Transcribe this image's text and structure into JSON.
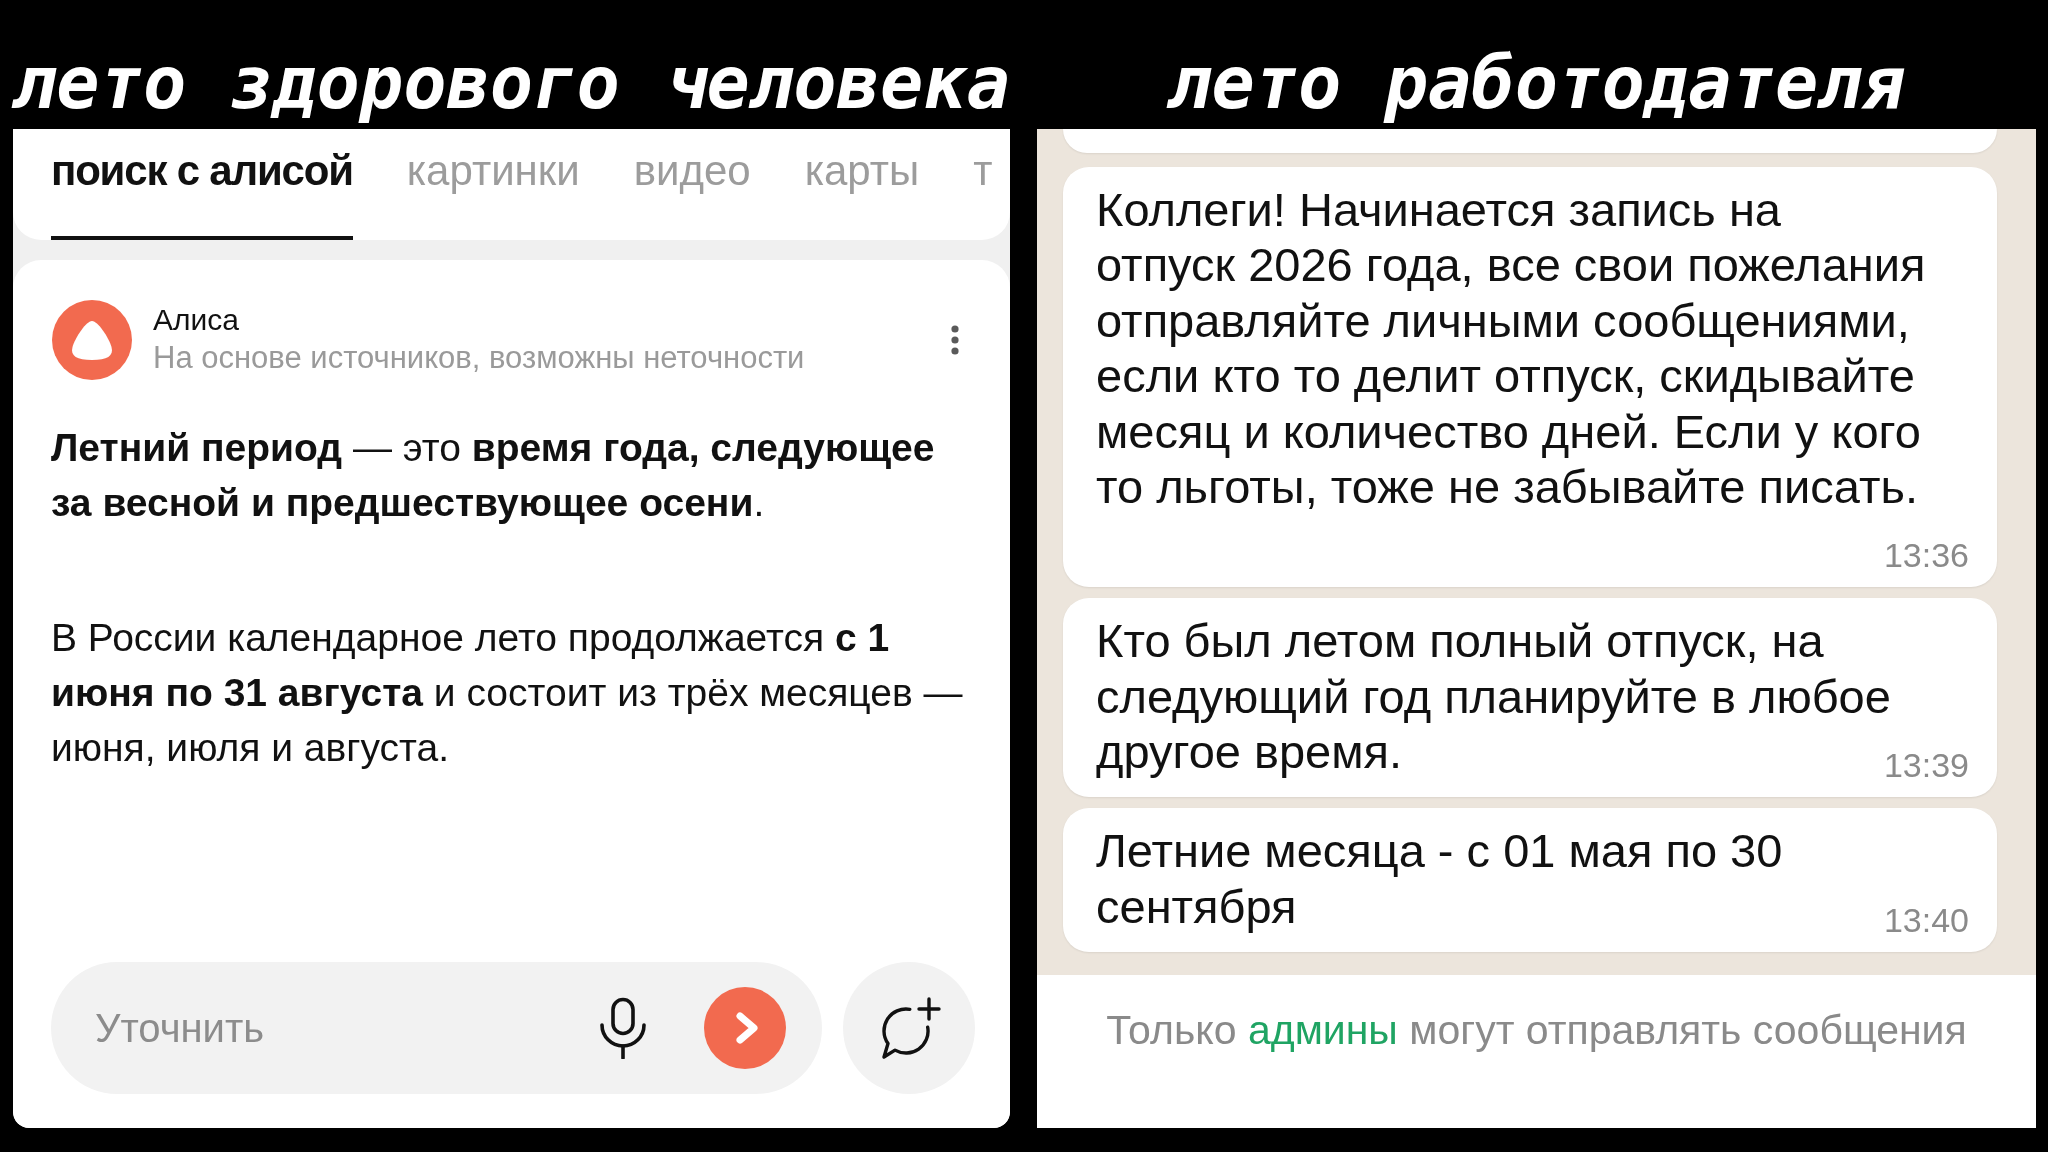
{
  "search_panel": {
    "caption": "лето здорового человека",
    "tabs": [
      {
        "label": "поиск с алисой",
        "selected": true
      },
      {
        "label": "картинки",
        "selected": false
      },
      {
        "label": "видео",
        "selected": false
      },
      {
        "label": "карты",
        "selected": false
      },
      {
        "label": "т",
        "selected": false
      }
    ],
    "answer": {
      "assistant_name": "Алиса",
      "disclaimer": "На основе источников, возможны неточности",
      "paragraphs": [
        "**Летний период** — это **время года, следующее**\n**за весной и предшествующее осени**.",
        "В России календарное лето продолжается **с 1**\n**июня по 31 августа** и состоит из трёх месяцев —\nиюня, июля и августа."
      ]
    },
    "input": {
      "placeholder": "Уточнить"
    }
  },
  "chat_panel": {
    "caption": "лето работодателя",
    "messages": [
      {
        "text": "Коллеги! Начинается запись на\nотпуск 2026 года, все свои пожелания\nотправляйте личными сообщениями,\nесли кто то делит отпуск, скидывайте\nмесяц и количество дней. Если у кого\nто льготы, тоже не забывайте писать.",
        "time": "13:36"
      },
      {
        "text": "Кто был летом полный отпуск, на\nследующий год планируйте в любое\nдругое время.",
        "time": "13:39"
      },
      {
        "text": "Летние месяца - с 01 мая по 30\nсентября",
        "time": "13:40"
      }
    ],
    "notice": {
      "text_before": "Только",
      "link": "админы",
      "text_after": "могут отправлять сообщения"
    }
  }
}
